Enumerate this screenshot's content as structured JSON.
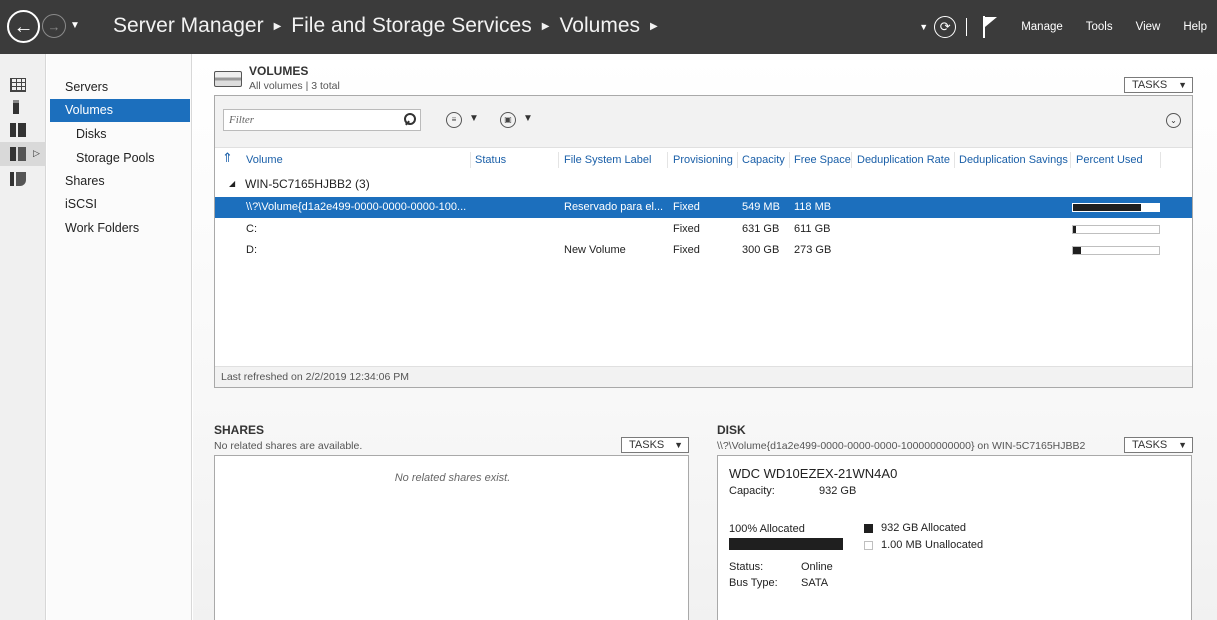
{
  "titlebar": {
    "breadcrumb": [
      "Server Manager",
      "File and Storage Services",
      "Volumes"
    ],
    "menu": [
      "Manage",
      "Tools",
      "View",
      "Help"
    ]
  },
  "sidebar": {
    "items": [
      {
        "label": "Servers",
        "sub": false,
        "active": false
      },
      {
        "label": "Volumes",
        "sub": false,
        "active": true
      },
      {
        "label": "Disks",
        "sub": true,
        "active": false
      },
      {
        "label": "Storage Pools",
        "sub": true,
        "active": false
      },
      {
        "label": "Shares",
        "sub": false,
        "active": false
      },
      {
        "label": "iSCSI",
        "sub": false,
        "active": false
      },
      {
        "label": "Work Folders",
        "sub": false,
        "active": false
      }
    ]
  },
  "volumes": {
    "title": "VOLUMES",
    "subtitle": "All volumes | 3 total",
    "tasks_label": "TASKS",
    "filter_placeholder": "Filter",
    "columns": [
      "Volume",
      "Status",
      "File System Label",
      "Provisioning",
      "Capacity",
      "Free Space",
      "Deduplication Rate",
      "Deduplication Savings",
      "Percent Used"
    ],
    "group": "WIN-5C7165HJBB2 (3)",
    "rows": [
      {
        "volume": "\\\\?\\Volume{d1a2e499-0000-0000-0000-100...",
        "status": "",
        "label": "Reservado para el...",
        "provisioning": "Fixed",
        "capacity": "549 MB",
        "free": "118 MB",
        "dedup_rate": "",
        "dedup_savings": "",
        "percent_used": 0.79,
        "selected": true
      },
      {
        "volume": "C:",
        "status": "",
        "label": "",
        "provisioning": "Fixed",
        "capacity": "631 GB",
        "free": "611 GB",
        "dedup_rate": "",
        "dedup_savings": "",
        "percent_used": 0.03,
        "selected": false
      },
      {
        "volume": "D:",
        "status": "",
        "label": "New Volume",
        "provisioning": "Fixed",
        "capacity": "300 GB",
        "free": "273 GB",
        "dedup_rate": "",
        "dedup_savings": "",
        "percent_used": 0.09,
        "selected": false
      }
    ],
    "footer": "Last refreshed on 2/2/2019 12:34:06 PM"
  },
  "shares": {
    "title": "SHARES",
    "subtitle": "No related shares are available.",
    "tasks_label": "TASKS",
    "empty": "No related shares exist."
  },
  "disk": {
    "title": "DISK",
    "subtitle": "\\\\?\\Volume{d1a2e499-0000-0000-0000-100000000000} on WIN-5C7165HJBB2",
    "tasks_label": "TASKS",
    "name": "WDC WD10EZEX-21WN4A0",
    "capacity_label": "Capacity:",
    "capacity_value": "932 GB",
    "allocated_text": "100% Allocated",
    "allocated_fraction": 1.0,
    "legend_allocated": "932 GB Allocated",
    "legend_unallocated": "1.00 MB Unallocated",
    "status_label": "Status:",
    "status_value": "Online",
    "bus_label": "Bus Type:",
    "bus_value": "SATA"
  }
}
